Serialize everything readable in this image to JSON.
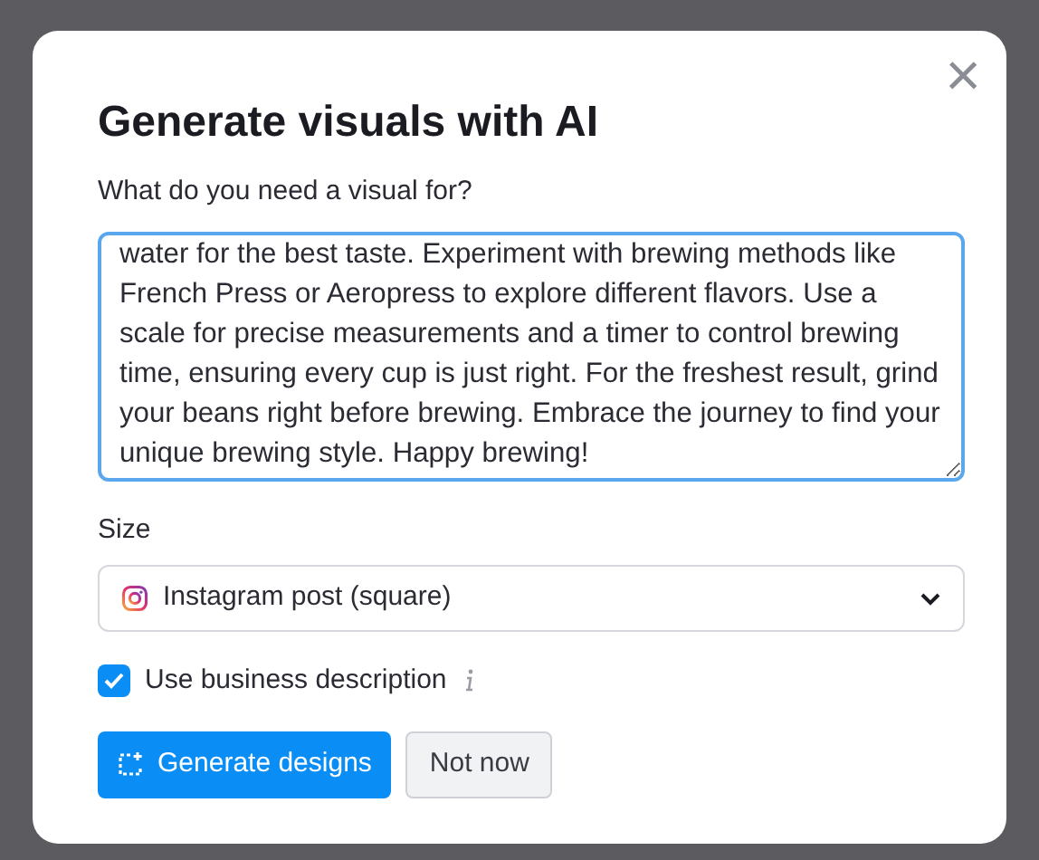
{
  "dialog": {
    "title": "Generate visuals with AI",
    "close_icon": "×",
    "prompt_label": "What do you need a visual for?",
    "prompt_value": "water for the best taste. Experiment with brewing methods like French Press or Aeropress to explore different flavors. Use a scale for precise measurements and a timer to control brewing time, ensuring every cup is just right. For the freshest result, grind your beans right before brewing. Embrace the journey to find your unique brewing style. Happy brewing!",
    "size_label": "Size",
    "size_value": "Instagram post (square)",
    "business_description": {
      "label": "Use business description",
      "checked": true
    },
    "buttons": [
      {
        "label": "Generate designs",
        "kind": "primary"
      },
      {
        "label": "Not now",
        "kind": "secondary"
      }
    ]
  }
}
